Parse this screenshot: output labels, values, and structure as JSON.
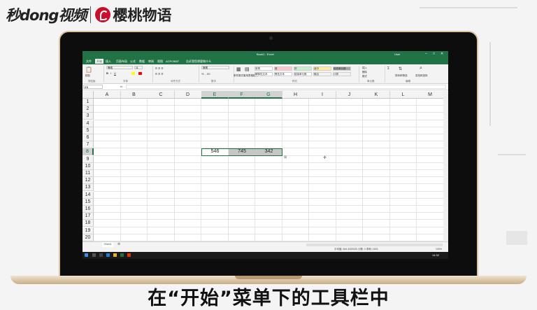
{
  "branding": {
    "logo_left": "秒dong视频",
    "logo_right": "樱桃物语"
  },
  "subtitle": "在“开始”菜单下的工具栏中",
  "excel": {
    "title": "Book1 - Excel",
    "user": "User",
    "window_controls": [
      "–",
      "□",
      "✕"
    ],
    "tabs": [
      "文件",
      "开始",
      "插入",
      "页面布局",
      "公式",
      "数据",
      "审阅",
      "视图",
      "ACROBAT",
      "告诉我您想要做什么"
    ],
    "active_tab": "开始",
    "ribbon": {
      "groups": [
        "剪贴板",
        "字体",
        "对齐方式",
        "数字",
        "样式",
        "单元格",
        "编辑"
      ],
      "font_name": "等线",
      "font_size": "11",
      "number_format": "常规",
      "styles": [
        {
          "label": "常规",
          "color": "#ffffff"
        },
        {
          "label": "差",
          "color": "#ffc7ce"
        },
        {
          "label": "好",
          "color": "#c6efce"
        },
        {
          "label": "适中",
          "color": "#ffeb9c"
        },
        {
          "label": "检查单元格",
          "color": "#a5a5a5"
        },
        {
          "label": "解释性文本",
          "color": "#ffffff"
        },
        {
          "label": "警告文本",
          "color": "#ffffff"
        },
        {
          "label": "链接单元格",
          "color": "#ffffff"
        },
        {
          "label": "输出",
          "color": "#f2f2f2"
        },
        {
          "label": "计算",
          "color": "#f2f2f2"
        }
      ],
      "buttons": [
        "粘贴",
        "条件格式",
        "套用表格格式",
        "插入",
        "删除",
        "格式",
        "排序和筛选",
        "查找和选择"
      ]
    },
    "name_box": "E8",
    "formula": "546",
    "columns": [
      "A",
      "B",
      "C",
      "D",
      "E",
      "F",
      "G",
      "H",
      "I",
      "J",
      "K",
      "L",
      "M"
    ],
    "rows": [
      "1",
      "2",
      "3",
      "4",
      "5",
      "6",
      "7",
      "8",
      "9",
      "10",
      "11",
      "12",
      "13",
      "14",
      "15",
      "16",
      "17",
      "18",
      "19",
      "20"
    ],
    "selected_row": "8",
    "cells": [
      {
        "col": "E",
        "row": "8",
        "value": "546"
      },
      {
        "col": "F",
        "row": "8",
        "value": "745"
      },
      {
        "col": "G",
        "row": "8",
        "value": "342"
      }
    ],
    "sheet_tab": "Sheet1",
    "status": {
      "stats": "平均值: 544.3333333  计数: 3  求和: 1633",
      "zoom": "100%"
    },
    "clock": "14:32",
    "accent": "#217346"
  }
}
